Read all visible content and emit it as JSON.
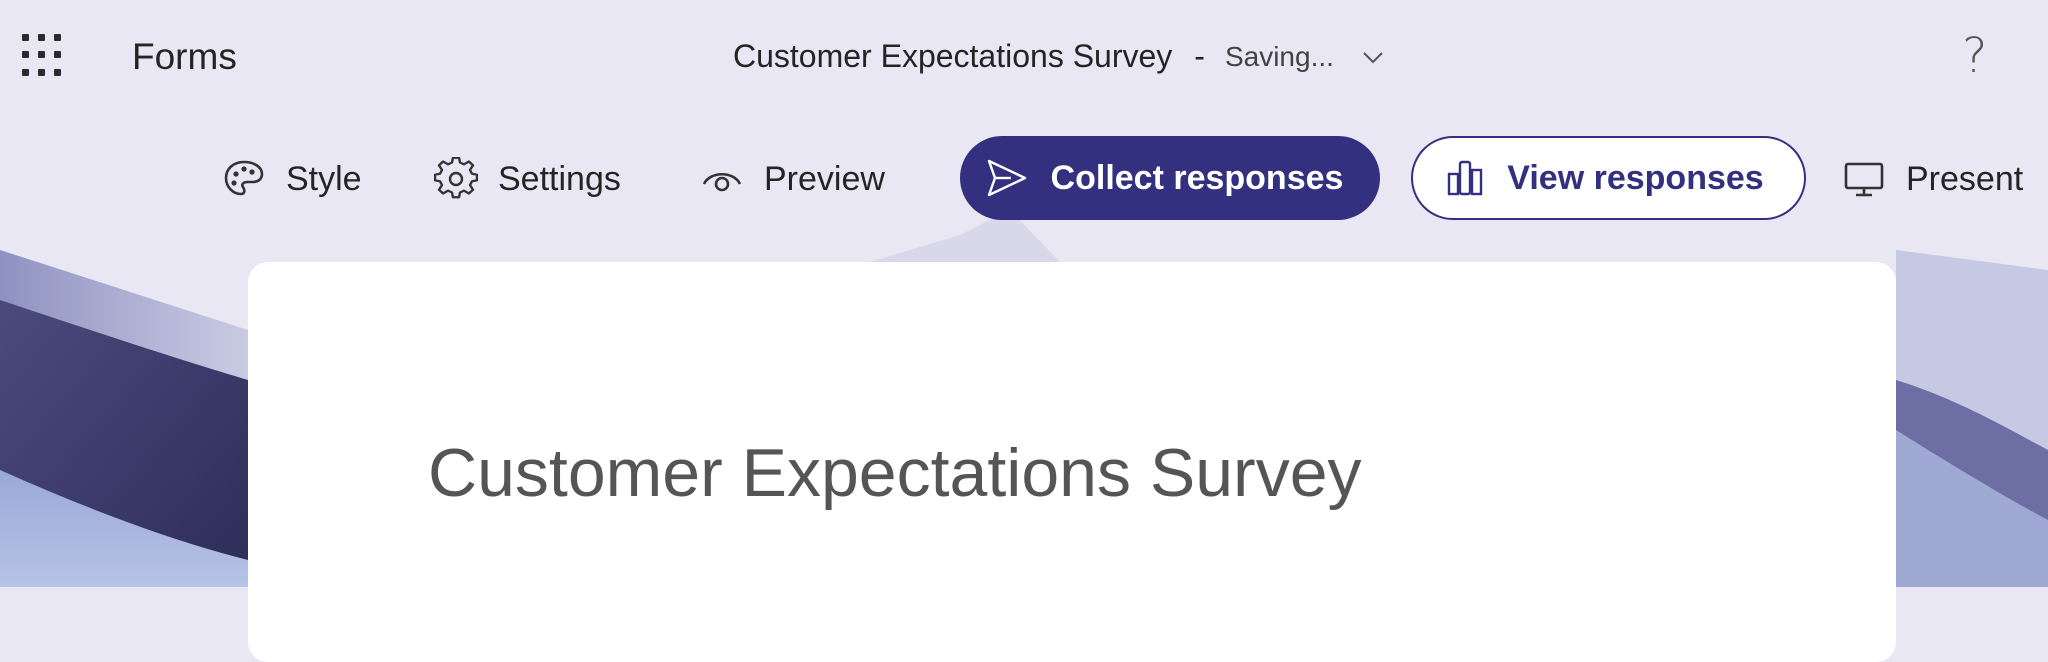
{
  "header": {
    "app_launcher_icon": "waffle-grid-icon",
    "app_name": "Forms",
    "document_title": "Customer Expectations Survey",
    "separator": "-",
    "save_status": "Saving...",
    "dropdown_icon": "chevron-down-icon",
    "help_label": "?"
  },
  "toolbar": {
    "style_label": "Style",
    "settings_label": "Settings",
    "preview_label": "Preview",
    "collect_label": "Collect responses",
    "view_label": "View responses",
    "present_label": "Present"
  },
  "form": {
    "title": "Customer Expectations Survey"
  },
  "colors": {
    "primary": "#32307f",
    "background": "#e8e7f3"
  }
}
